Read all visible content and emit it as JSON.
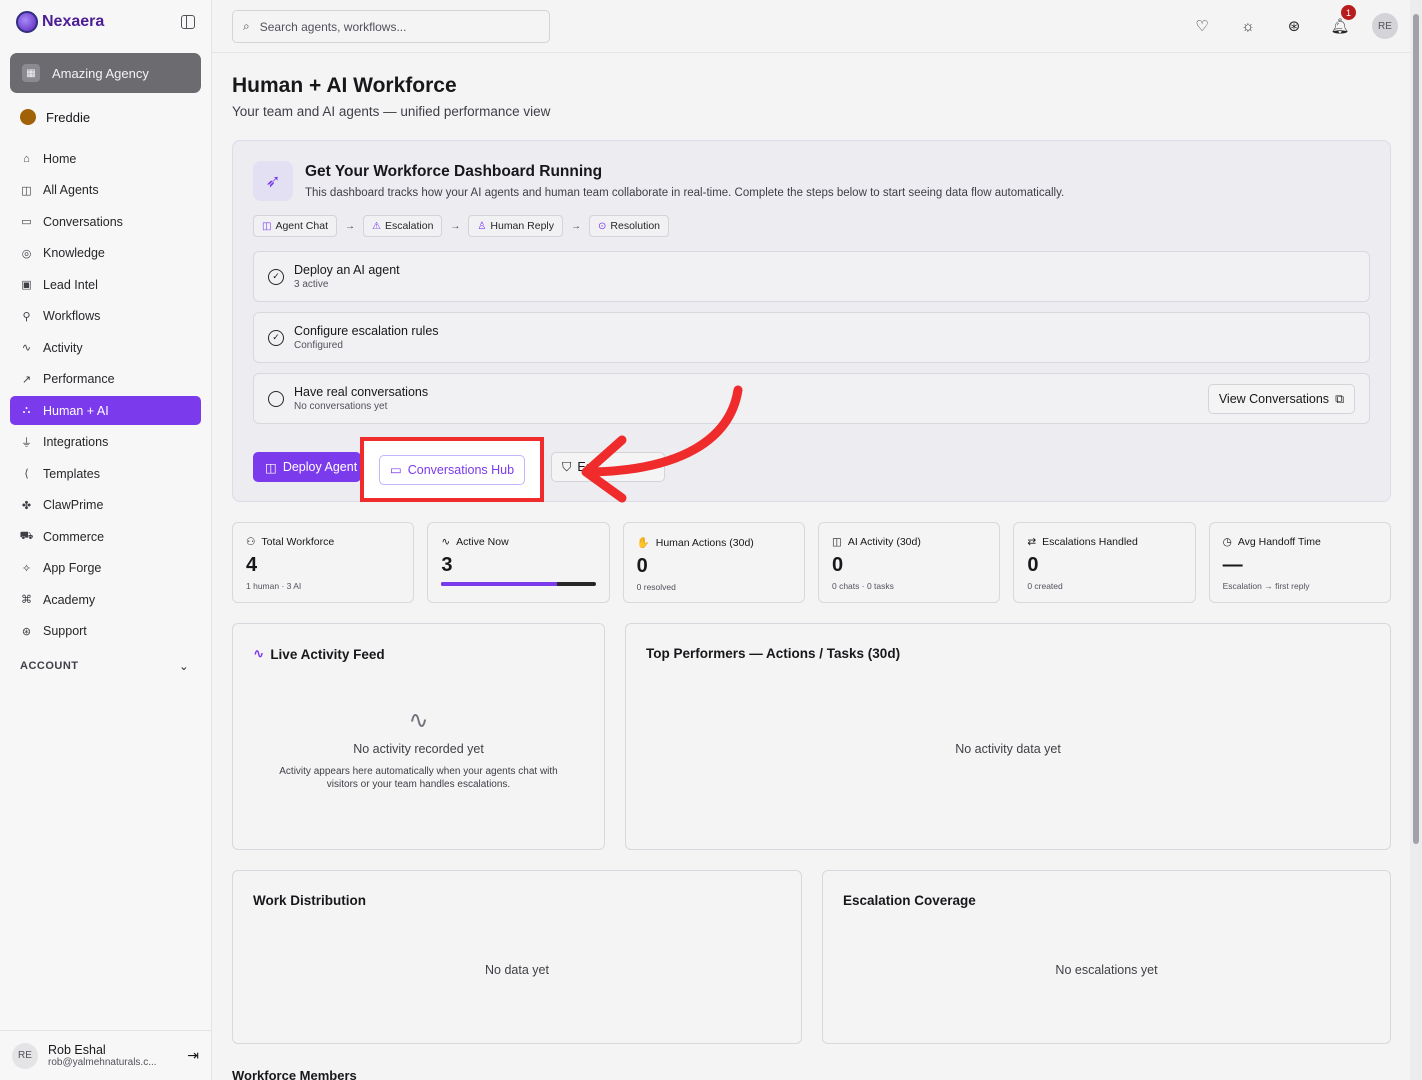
{
  "brand": "Nexaera",
  "sidebar": {
    "agency": "Amazing Agency",
    "user": "Freddie",
    "items": [
      {
        "label": "Home",
        "icon": "⌂"
      },
      {
        "label": "All Agents",
        "icon": "◫"
      },
      {
        "label": "Conversations",
        "icon": "▭"
      },
      {
        "label": "Knowledge",
        "icon": "◎"
      },
      {
        "label": "Lead Intel",
        "icon": "▣"
      },
      {
        "label": "Workflows",
        "icon": "⚲"
      },
      {
        "label": "Activity",
        "icon": "∿"
      },
      {
        "label": "Performance",
        "icon": "↗"
      },
      {
        "label": "Human + AI",
        "icon": "⛬"
      },
      {
        "label": "Integrations",
        "icon": "⏚"
      },
      {
        "label": "Templates",
        "icon": "⟨"
      },
      {
        "label": "ClawPrime",
        "icon": "✤"
      },
      {
        "label": "Commerce",
        "icon": "⛟"
      },
      {
        "label": "App Forge",
        "icon": "✧"
      },
      {
        "label": "Academy",
        "icon": "⌘"
      },
      {
        "label": "Support",
        "icon": "⊛"
      }
    ],
    "active_index": 8,
    "account_label": "ACCOUNT",
    "footer": {
      "initials": "RE",
      "name": "Rob Eshal",
      "email": "rob@yalmehnaturals.c..."
    }
  },
  "topbar": {
    "search_placeholder": "Search agents, workflows...",
    "notifications_count": "1",
    "avatar_initials": "RE"
  },
  "page": {
    "title": "Human + AI Workforce",
    "subtitle": "Your team and AI agents — unified performance view"
  },
  "setup": {
    "title": "Get Your Workforce Dashboard Running",
    "description": "This dashboard tracks how your AI agents and human team collaborate in real-time. Complete the steps below to start seeing data flow automatically.",
    "pipeline": [
      "Agent Chat",
      "Escalation",
      "Human Reply",
      "Resolution"
    ],
    "steps": [
      {
        "title": "Deploy an AI agent",
        "sub": "3 active",
        "done": true
      },
      {
        "title": "Configure escalation rules",
        "sub": "Configured",
        "done": true
      },
      {
        "title": "Have real conversations",
        "sub": "No conversations yet",
        "done": false
      }
    ],
    "view_conversations": "View Conversations",
    "deploy_agent": "Deploy Agent",
    "conversations_hub": "Conversations Hub",
    "escalation_partial": "Esc"
  },
  "stats": [
    {
      "label": "Total Workforce",
      "value": "4",
      "sub": "1 human · 3 AI",
      "icon": "⚇"
    },
    {
      "label": "Active Now",
      "value": "3",
      "sub": "",
      "icon": "∿",
      "progress": 0.75
    },
    {
      "label": "Human Actions (30d)",
      "value": "0",
      "sub": "0 resolved",
      "icon": "✋"
    },
    {
      "label": "AI Activity (30d)",
      "value": "0",
      "sub": "0 chats · 0 tasks",
      "icon": "◫"
    },
    {
      "label": "Escalations Handled",
      "value": "0",
      "sub": "0 created",
      "icon": "⇄"
    },
    {
      "label": "Avg Handoff Time",
      "value": "—",
      "sub": "Escalation → first reply",
      "icon": "◷"
    }
  ],
  "feed": {
    "title": "Live Activity Feed",
    "empty_title": "No activity recorded yet",
    "empty_desc_1": "Activity appears here automatically when your agents chat with",
    "empty_desc_2": "visitors or your team handles escalations."
  },
  "top_performers": {
    "title": "Top Performers — Actions / Tasks (30d)",
    "empty": "No activity data yet"
  },
  "work_distribution": {
    "title": "Work Distribution",
    "empty": "No data yet"
  },
  "escalation_coverage": {
    "title": "Escalation Coverage",
    "empty": "No escalations yet"
  },
  "workforce_members": {
    "title": "Workforce Members"
  },
  "colors": {
    "accent": "#7c3aed",
    "highlight": "#ef2b2b"
  }
}
